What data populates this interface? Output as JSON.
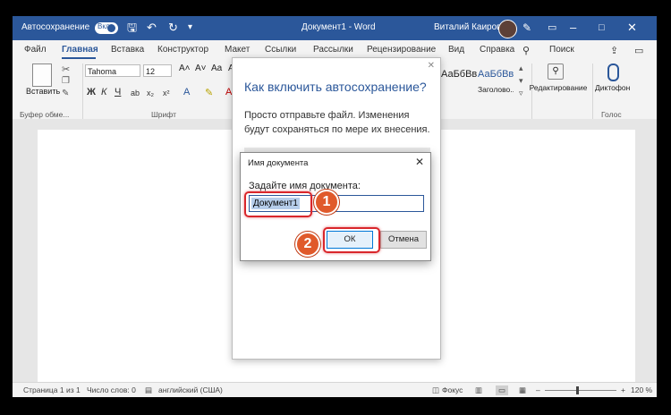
{
  "titlebar": {
    "autosave_label": "Автосохранение",
    "autosave_state": "Вкл",
    "doc_title": "Документ1 - Word",
    "user_name": "Виталий Каиров",
    "color": "#2b579a"
  },
  "tabs": [
    "Файл",
    "Главная",
    "Вставка",
    "Конструктор",
    "Макет",
    "Ссылки",
    "Рассылки",
    "Рецензирование",
    "Вид",
    "Справка"
  ],
  "tabs_active": "Главная",
  "search_label": "Поиск",
  "ribbon": {
    "paste_label": "Вставить",
    "clipboard_group": "Буфер обме...",
    "font_group": "Шрифт",
    "font_name": "Tahoma",
    "font_size": "12",
    "fmt_buttons": [
      "Ж",
      "К",
      "Ч"
    ],
    "styles": [
      {
        "sample": "АаБбВвГ",
        "name": ""
      },
      {
        "sample": "АаБбВв",
        "name": "Заголово..."
      }
    ],
    "editing_label": "Редактирование",
    "dictation_label": "Диктофон",
    "voice_group": "Голос"
  },
  "panel": {
    "title": "Как включить автосохранение?",
    "description": "Просто отправьте файл. Изменения будут сохраняться по мере их внесения."
  },
  "dialog": {
    "title": "Имя документа",
    "label": "Задайте имя документа:",
    "value": "Документ1",
    "ok": "ОК",
    "cancel": "Отмена"
  },
  "markers": [
    "1",
    "2"
  ],
  "statusbar": {
    "page": "Страница 1 из 1",
    "words": "Число слов: 0",
    "language": "английский (США)",
    "focus": "Фокус",
    "zoom": "120 %"
  }
}
